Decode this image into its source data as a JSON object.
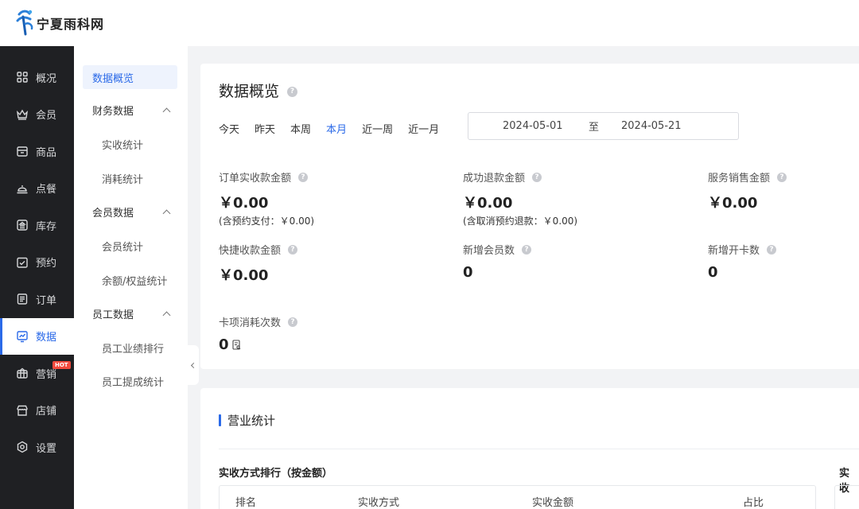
{
  "brand": {
    "name": "宁夏雨科网"
  },
  "sidebar": {
    "items": [
      {
        "label": "概况",
        "icon": "dashboard-grid-icon"
      },
      {
        "label": "会员",
        "icon": "crown-icon"
      },
      {
        "label": "商品",
        "icon": "goods-box-icon"
      },
      {
        "label": "点餐",
        "icon": "cloche-icon"
      },
      {
        "label": "库存",
        "icon": "warehouse-icon"
      },
      {
        "label": "预约",
        "icon": "calendar-check-icon"
      },
      {
        "label": "订单",
        "icon": "order-list-icon"
      },
      {
        "label": "数据",
        "icon": "chart-monitor-icon",
        "active": true
      },
      {
        "label": "营销",
        "icon": "gift-shop-icon",
        "badge": "HOT"
      },
      {
        "label": "店铺",
        "icon": "store-icon"
      },
      {
        "label": "设置",
        "icon": "settings-icon"
      }
    ]
  },
  "submenu": {
    "overview": "数据概览",
    "finance": {
      "label": "财务数据",
      "children": [
        "实收统计",
        "消耗统计"
      ]
    },
    "member": {
      "label": "会员数据",
      "children": [
        "会员统计",
        "余额/权益统计"
      ]
    },
    "staff": {
      "label": "员工数据",
      "children": [
        "员工业绩排行",
        "员工提成统计"
      ]
    }
  },
  "overview": {
    "title": "数据概览",
    "ranges": [
      "今天",
      "昨天",
      "本周",
      "本月",
      "近一周",
      "近一月"
    ],
    "active_range": "本月",
    "date_start": "2024-05-01",
    "date_sep": "至",
    "date_end": "2024-05-21",
    "metrics": [
      {
        "label": "订单实收款金额",
        "value": "￥0.00",
        "sub": "(含预约支付：￥0.00)"
      },
      {
        "label": "成功退款金额",
        "value": "￥0.00",
        "sub": "(含取消预约退款：￥0.00)"
      },
      {
        "label": "服务销售金额",
        "value": "￥0.00"
      },
      {
        "label": "快捷收款金额",
        "value": "￥0.00"
      },
      {
        "label": "新增会员数",
        "value": "0"
      },
      {
        "label": "新增开卡数",
        "value": "0"
      },
      {
        "label": "卡项消耗次数",
        "value": "0"
      }
    ]
  },
  "business": {
    "title": "营业统计",
    "table_title": "实收方式排行（按金额）",
    "table2_title": "实收",
    "columns": [
      "排名",
      "实收方式",
      "实收金额",
      "占比"
    ]
  },
  "colors": {
    "accent": "#2b6ae8",
    "sidebar_bg": "#1f2023",
    "hot": "#f24a3d"
  }
}
